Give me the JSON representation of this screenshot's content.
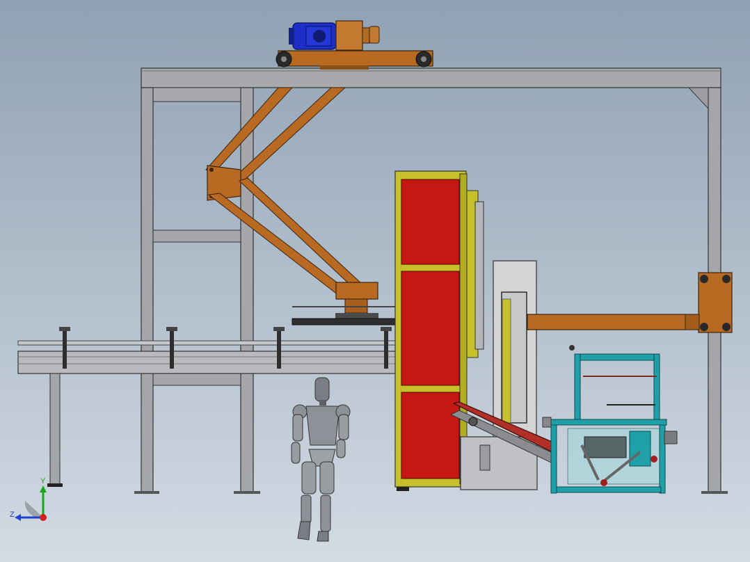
{
  "viewport": {
    "name": "cad-graphics-area",
    "background_top": "#8fa1b3",
    "background_bottom": "#d3dbe4"
  },
  "colors": {
    "frame_steel": "#a4a6aa",
    "frame_edge": "#3a3a3a",
    "gantry_orange": "#b86a22",
    "motor_blue": "#1c2fc8",
    "gearbox_orange": "#c47a30",
    "hopper_red": "#c61812",
    "hopper_frame_yellow": "#c6c02a",
    "machine_teal": "#1fa0a8",
    "conveyor_grey": "#b8babd",
    "robot_grey": "#8e9298"
  },
  "triad": {
    "y_label": "Y",
    "z_label": "Z",
    "y_axis_color": "#1aa51a",
    "z_axis_color": "#2040d0",
    "x_axis_color": "#d02020"
  },
  "model": {
    "components": [
      "gantry-frame",
      "trolley-motor",
      "manipulator-arm",
      "infeed-conveyor",
      "hopper-column",
      "guide-rail-panel",
      "side-arm",
      "inclined-chute",
      "teal-packing-machine",
      "humanoid-figure"
    ]
  }
}
